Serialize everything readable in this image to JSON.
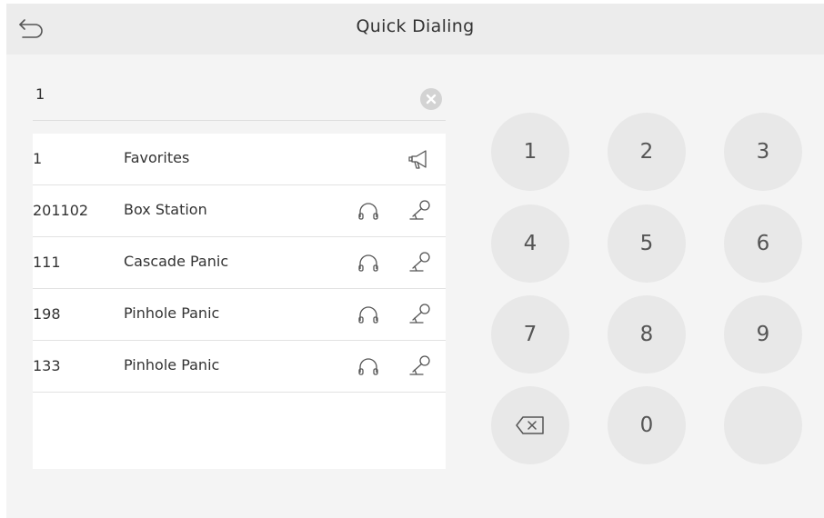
{
  "header": {
    "title": "Quick Dialing"
  },
  "dial_input": {
    "value": "1"
  },
  "results": [
    {
      "number": "1",
      "name": "Favorites",
      "type": "favorites"
    },
    {
      "number": "201102",
      "name": "Box Station",
      "type": "station"
    },
    {
      "number": "111",
      "name": "Cascade Panic",
      "type": "station"
    },
    {
      "number": "198",
      "name": "Pinhole Panic",
      "type": "station"
    },
    {
      "number": "133",
      "name": "Pinhole Panic",
      "type": "station"
    }
  ],
  "keypad": {
    "keys": [
      "1",
      "2",
      "3",
      "4",
      "5",
      "6",
      "7",
      "8",
      "9",
      "",
      "0",
      ""
    ]
  },
  "icons": {
    "back": "back-arrow-icon",
    "clear": "clear-input-icon",
    "favorites": "megaphone-icon",
    "monitor": "headset-icon",
    "call": "microphone-icon",
    "backspace": "backspace-icon"
  },
  "colors": {
    "background": "#f4f4f4",
    "title_bar": "#ececec",
    "key": "#e8e8e8",
    "list_background": "#ffffff",
    "text": "#333333"
  }
}
